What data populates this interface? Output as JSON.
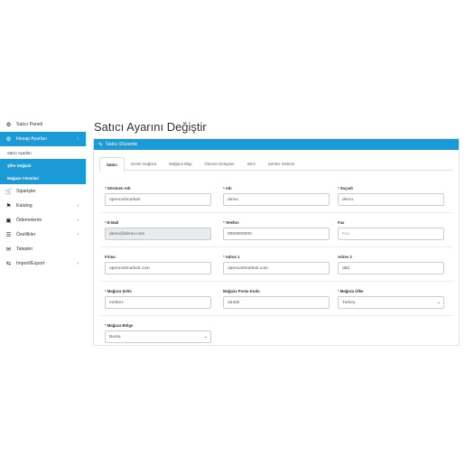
{
  "sidebar": {
    "items": [
      {
        "icon": "dashboard-icon",
        "label": "Satıcı Paneli"
      },
      {
        "icon": "gear-icon",
        "label": "Hesap Ayarları"
      },
      {
        "icon": "cart-icon",
        "label": "Siparişler"
      },
      {
        "icon": "tag-icon",
        "label": "Katalog"
      },
      {
        "icon": "credit-card-icon",
        "label": "Ödemelerim"
      },
      {
        "icon": "list-icon",
        "label": "Özellikler"
      },
      {
        "icon": "envelope-icon",
        "label": "Talepler"
      },
      {
        "icon": "exchange-icon",
        "label": "Import/Export"
      }
    ],
    "sub_items": [
      "Satıcı Ayarları",
      "Şifre Değiştir",
      "Mağaza Yönetimi"
    ]
  },
  "page": {
    "title": "Satıcı Ayarını Değiştir",
    "panel_title": "Satıcı Düzenle"
  },
  "tabs": [
    "Satıcı",
    "Genel mağaza",
    "Mağaza Bilgi",
    "Ödeme Detayları",
    "SEO",
    "Şehtez Sistemi"
  ],
  "form": {
    "display_name": {
      "label": "Görünen Adı",
      "value": "opencartmarketi",
      "required": true
    },
    "first_name": {
      "label": "Adı",
      "value": "demo",
      "required": true
    },
    "last_name": {
      "label": "Soyadı",
      "value": "demo",
      "required": true
    },
    "email": {
      "label": "E-Mail",
      "value": "demo@demo.com",
      "required": true
    },
    "phone": {
      "label": "Telefon",
      "value": "0000000000",
      "required": true
    },
    "fax": {
      "label": "Fax",
      "placeholder": "Fax",
      "required": false
    },
    "company": {
      "label": "Firma",
      "value": "opencartmarketi.com",
      "required": false
    },
    "address1": {
      "label": "Adres 1",
      "value": "opencartmarketi.com",
      "required": true
    },
    "address2": {
      "label": "Adres 2",
      "value": "ddd",
      "required": false
    },
    "city": {
      "label": "Mağaza Şehir",
      "value": "merkez",
      "required": true
    },
    "postcode": {
      "label": "Mağaza Posta Kodu",
      "value": "16400",
      "required": false
    },
    "country": {
      "label": "Mağaza Ülke",
      "value": "Turkey",
      "required": true
    },
    "region": {
      "label": "Mağaza Bölge",
      "value": "Bursa",
      "required": true
    }
  },
  "colors": {
    "accent": "#1a9ad6",
    "required": "#e23333"
  }
}
